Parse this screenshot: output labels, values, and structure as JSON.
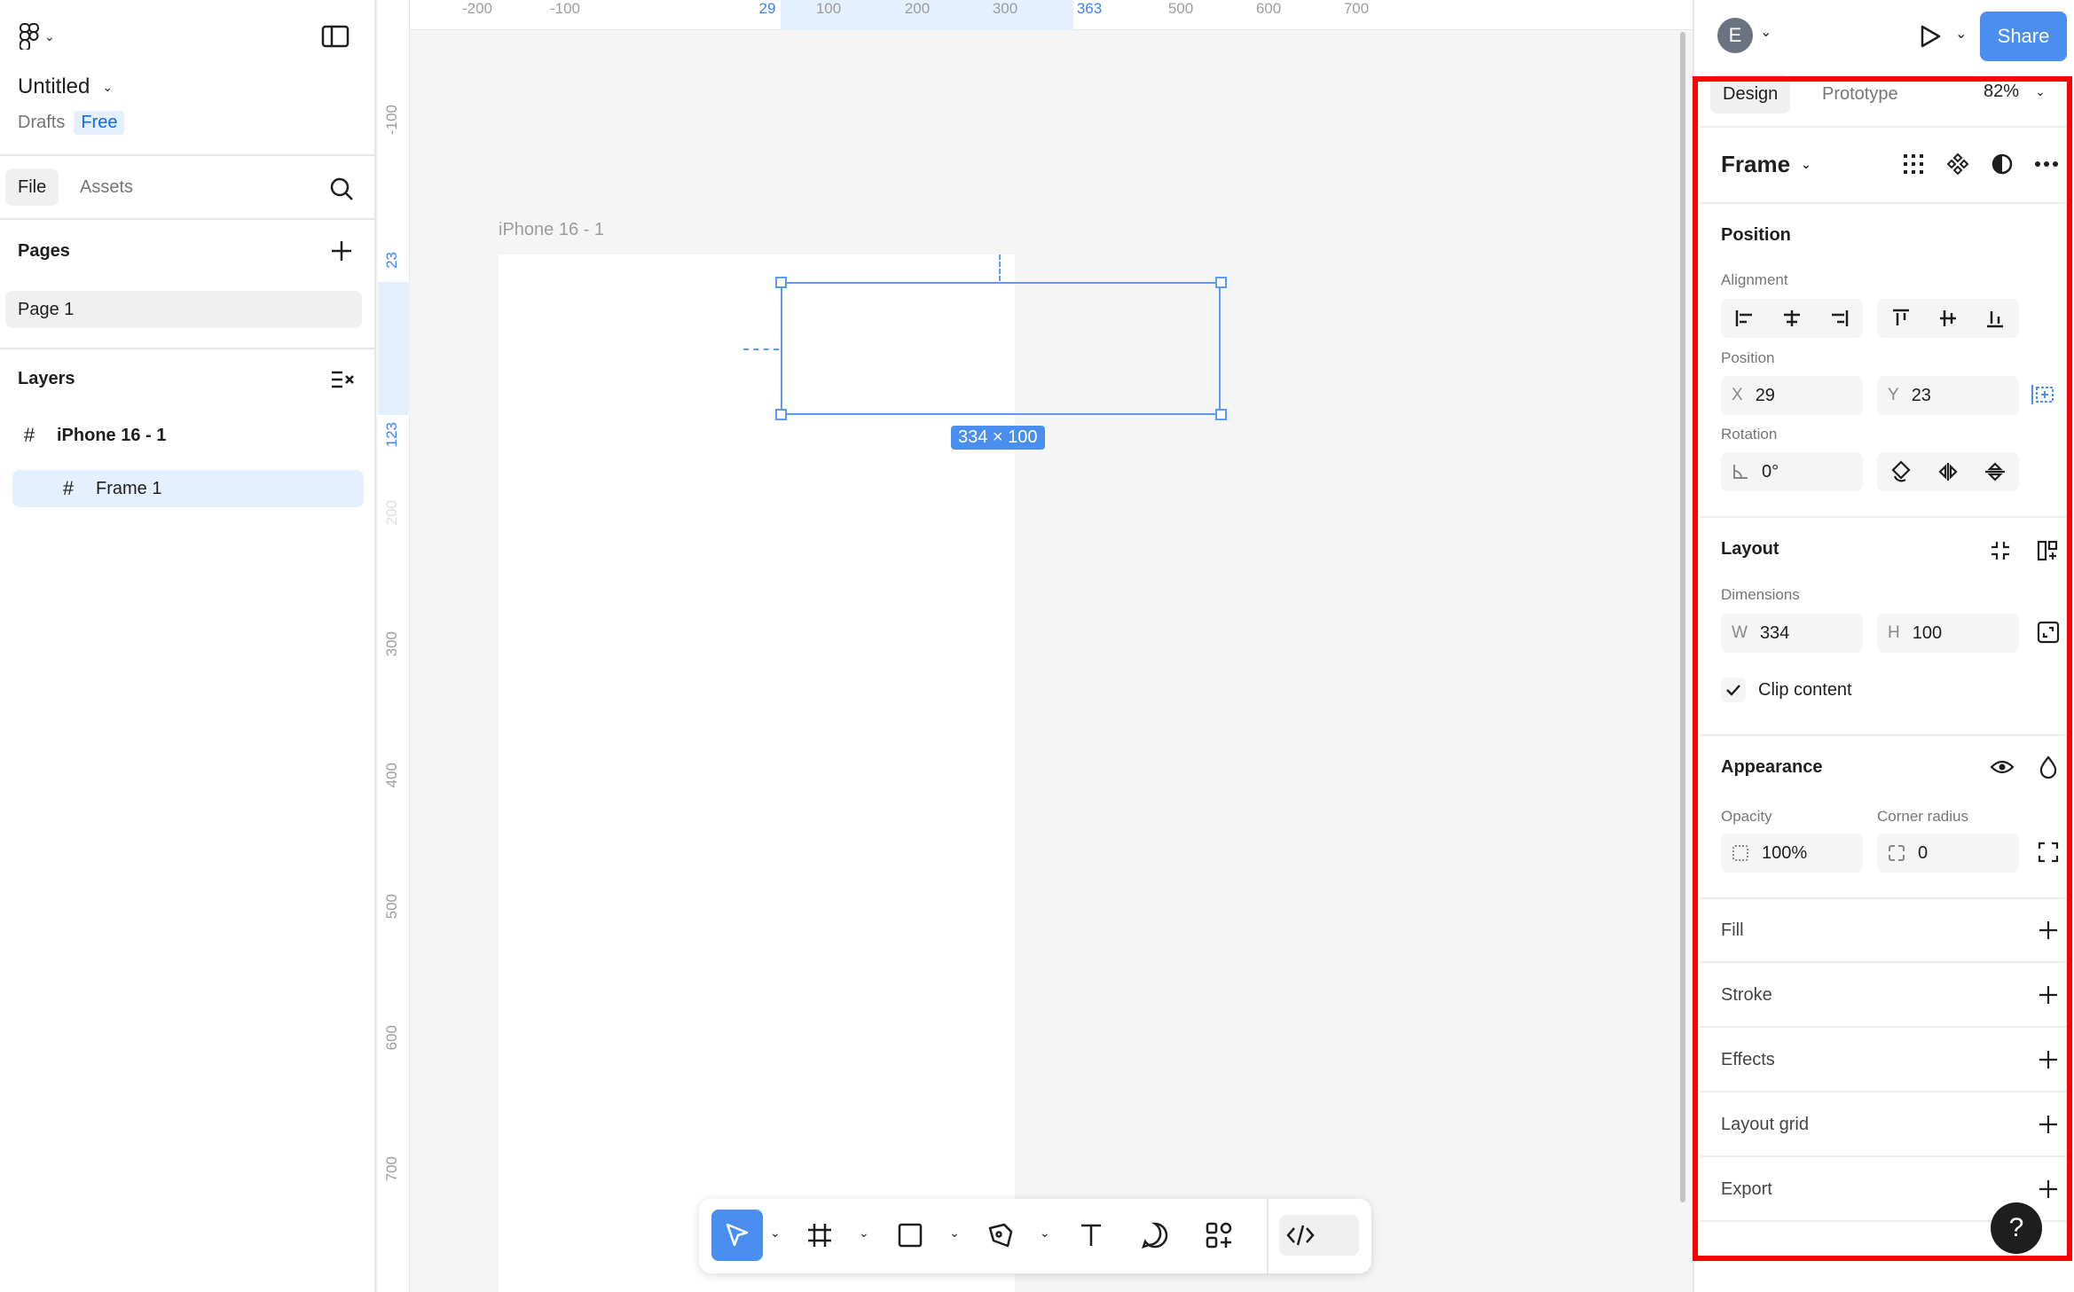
{
  "file": {
    "title": "Untitled",
    "location": "Drafts",
    "plan": "Free"
  },
  "left_tabs": {
    "file": "File",
    "assets": "Assets"
  },
  "pages": {
    "heading": "Pages",
    "items": [
      "Page 1"
    ]
  },
  "layers": {
    "heading": "Layers",
    "items": [
      {
        "name": "iPhone 16 - 1"
      },
      {
        "name": "Frame 1"
      }
    ]
  },
  "canvas": {
    "frame_label": "iPhone 16 - 1",
    "selection_size": "334 × 100",
    "ruler_top": [
      "-200",
      "-100",
      "29",
      "100",
      "200",
      "300",
      "363",
      "500",
      "600",
      "700"
    ],
    "ruler_left": [
      "-100",
      "23",
      "123",
      "200",
      "300",
      "400",
      "500",
      "600",
      "700"
    ]
  },
  "header": {
    "avatar_initial": "E",
    "share_label": "Share"
  },
  "right_tabs": {
    "design": "Design",
    "prototype": "Prototype",
    "zoom": "82%"
  },
  "frame_panel": {
    "title": "Frame"
  },
  "position": {
    "heading": "Position",
    "alignment_label": "Alignment",
    "position_label": "Position",
    "x_prefix": "X",
    "x_value": "29",
    "y_prefix": "Y",
    "y_value": "23",
    "rotation_label": "Rotation",
    "rotation_value": "0°"
  },
  "layout": {
    "heading": "Layout",
    "dimensions_label": "Dimensions",
    "w_prefix": "W",
    "w_value": "334",
    "h_prefix": "H",
    "h_value": "100",
    "clip_label": "Clip content"
  },
  "appearance": {
    "heading": "Appearance",
    "opacity_label": "Opacity",
    "opacity_value": "100%",
    "radius_label": "Corner radius",
    "radius_value": "0"
  },
  "sections": [
    "Fill",
    "Stroke",
    "Effects",
    "Layout grid",
    "Export"
  ],
  "help_label": "?",
  "colors": {
    "accent": "#4a8ef0",
    "highlight": "#ff0000"
  }
}
